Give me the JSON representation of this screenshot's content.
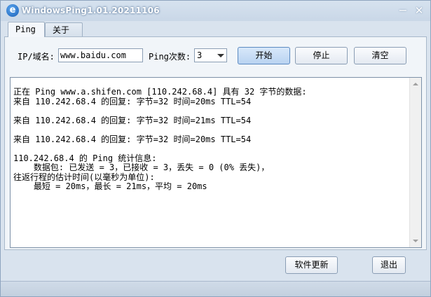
{
  "window": {
    "title": "WindowsPing1.01.20211106",
    "app_icon_glyph": "e",
    "minimize_glyph": "−",
    "close_glyph": "✕"
  },
  "tabs": [
    {
      "label": "Ping",
      "selected": true
    },
    {
      "label": "关于",
      "selected": false
    }
  ],
  "toolbar": {
    "ip_label": "IP/域名:",
    "ip_value": "www.baidu.com",
    "count_label": "Ping次数:",
    "count_value": "3",
    "start_label": "开始",
    "stop_label": "停止",
    "clear_label": "清空"
  },
  "output": {
    "lines": [
      "正在 Ping www.a.shifen.com [110.242.68.4] 具有 32 字节的数据:",
      "来自 110.242.68.4 的回复: 字节=32 时间=20ms TTL=54",
      "",
      "来自 110.242.68.4 的回复: 字节=32 时间=21ms TTL=54",
      "",
      "来自 110.242.68.4 的回复: 字节=32 时间=20ms TTL=54",
      "",
      "110.242.68.4 的 Ping 统计信息:",
      "    数据包: 已发送 = 3，已接收 = 3，丢失 = 0 (0% 丢失)，",
      "往返行程的估计时间(以毫秒为单位):",
      "    最短 = 20ms，最长 = 21ms，平均 = 20ms"
    ]
  },
  "footer": {
    "update_label": "软件更新",
    "exit_label": "退出"
  },
  "colors": {
    "accent_button": "#b9d3f1",
    "window_bg": "#d9e3ee"
  }
}
